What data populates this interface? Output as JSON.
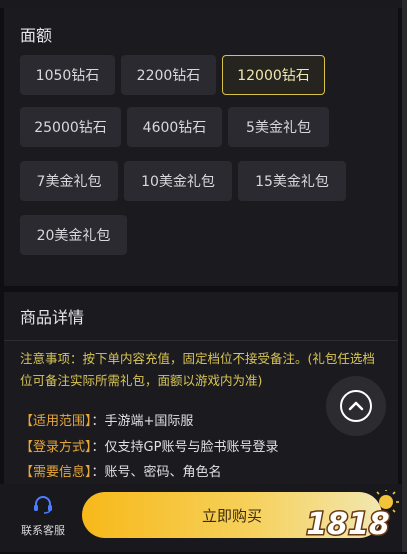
{
  "amount_section": {
    "title": "面额",
    "options": [
      {
        "label": "1050钻石"
      },
      {
        "label": "2200钻石"
      },
      {
        "label": "12000钻石",
        "selected": true
      },
      {
        "label": "25000钻石"
      },
      {
        "label": "4600钻石"
      },
      {
        "label": "5美金礼包"
      },
      {
        "label": "7美金礼包"
      },
      {
        "label": "10美金礼包"
      },
      {
        "label": "15美金礼包"
      },
      {
        "label": "20美金礼包"
      }
    ]
  },
  "details_section": {
    "title": "商品详情",
    "notice": "注意事项：按下单内容充值，固定档位不接受备注。(礼包任选档位可备注实际所需礼包，面额以游戏内为准)",
    "info": [
      {
        "key": "【适用范围】",
        "sep": "：",
        "value": "手游端+国际服"
      },
      {
        "key": "【登录方式】",
        "sep": "：",
        "value": "仅支持GP账号与脸书账号登录"
      },
      {
        "key": "【需要信息】",
        "sep": "：",
        "value": "账号、密码、角色名"
      }
    ]
  },
  "bottom_bar": {
    "customer_service_label": "联系客服",
    "buy_label": "立即购买"
  },
  "logo_text": "1818",
  "colors": {
    "accent_gold": "#d9c24a",
    "notice_yellow": "#d8c455",
    "key_orange": "#e7a73a",
    "button_gradient_start": "#f7b91a"
  },
  "icons": {
    "fab": "chevron-up-icon",
    "customer_service": "headset-icon"
  }
}
